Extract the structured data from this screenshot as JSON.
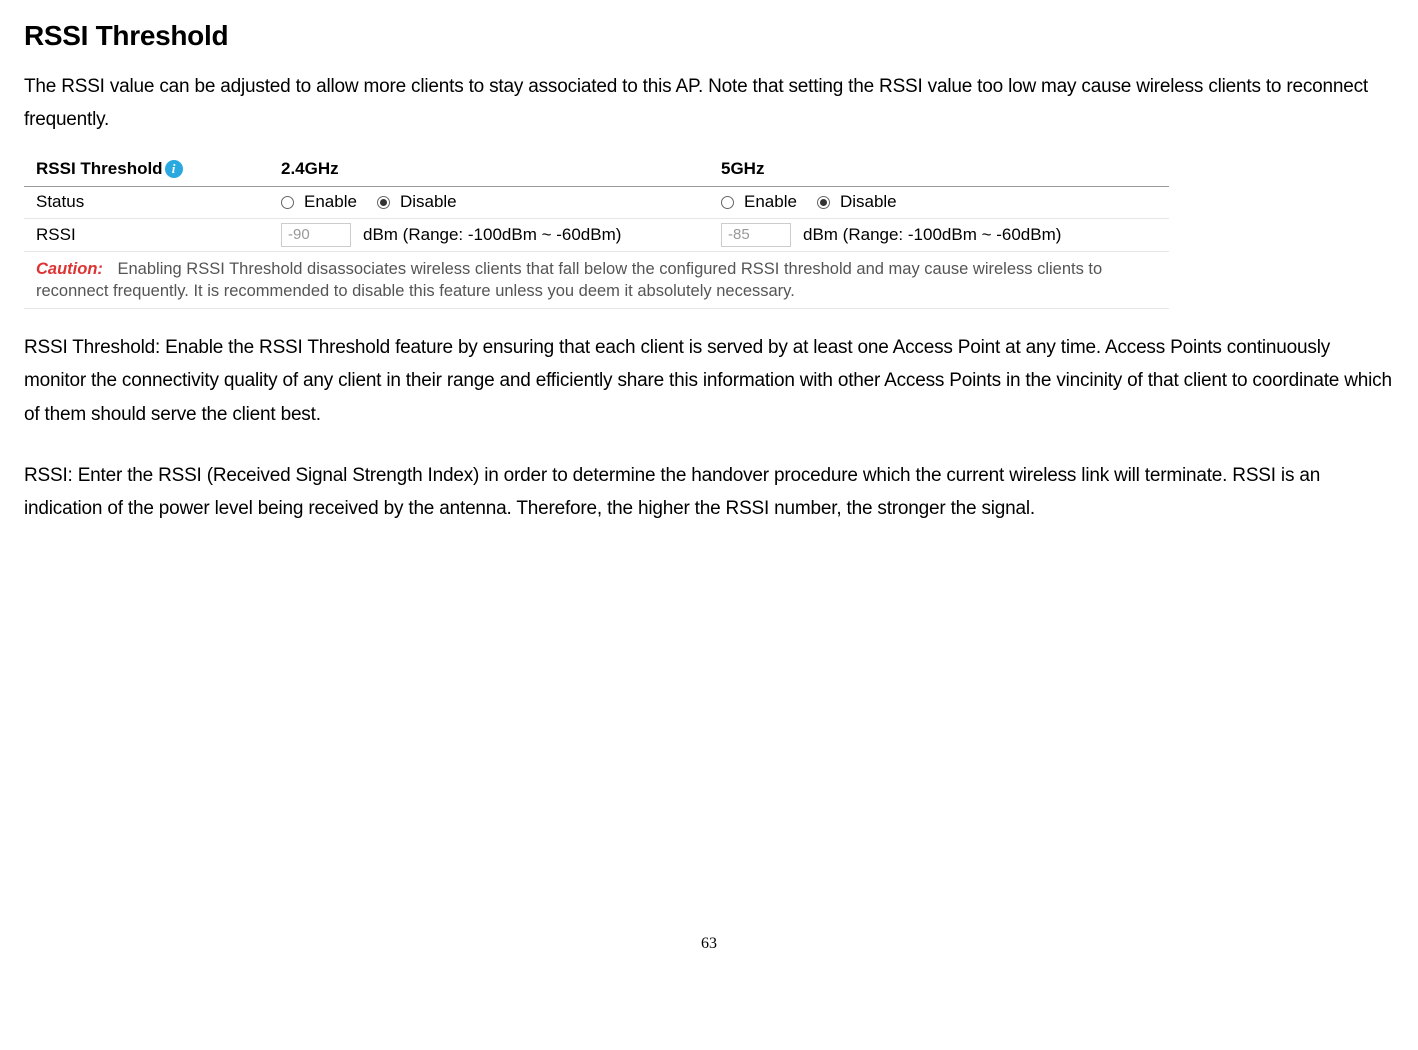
{
  "heading": "RSSI Threshold",
  "intro": "The RSSI value can be adjusted to allow more clients to stay associated to this AP. Note that setting the RSSI value too low may cause wireless clients to reconnect frequently.",
  "panel": {
    "header": {
      "label": "RSSI Threshold",
      "col24": "2.4GHz",
      "col5": "5GHz"
    },
    "status": {
      "label": "Status",
      "enable": "Enable",
      "disable": "Disable",
      "selected24": "disable",
      "selected5": "disable"
    },
    "rssi": {
      "label": "RSSI",
      "value24": "-90",
      "value5": "-85",
      "unit": "dBm (Range: -100dBm ~ -60dBm)"
    },
    "caution": {
      "label": "Caution:",
      "text": "Enabling RSSI Threshold disassociates wireless clients that fall below the configured RSSI threshold and may cause wireless clients to reconnect frequently. It is recommended to disable this feature unless you deem it absolutely necessary."
    }
  },
  "desc1": "RSSI Threshold: Enable the RSSI Threshold feature by ensuring that each client is served by at least one Access Point at any time. Access Points continuously monitor the connectivity quality of any client in their range and efficiently share this information with other Access Points in the vincinity of that client to coordinate which of them should serve the client best.",
  "desc2": "RSSI: Enter the RSSI (Received Signal Strength Index) in order to determine the handover procedure which the current wireless link will terminate. RSSI is an indication of the power level being received by the antenna. Therefore, the higher the RSSI number, the stronger the signal.",
  "pageNumber": "63"
}
